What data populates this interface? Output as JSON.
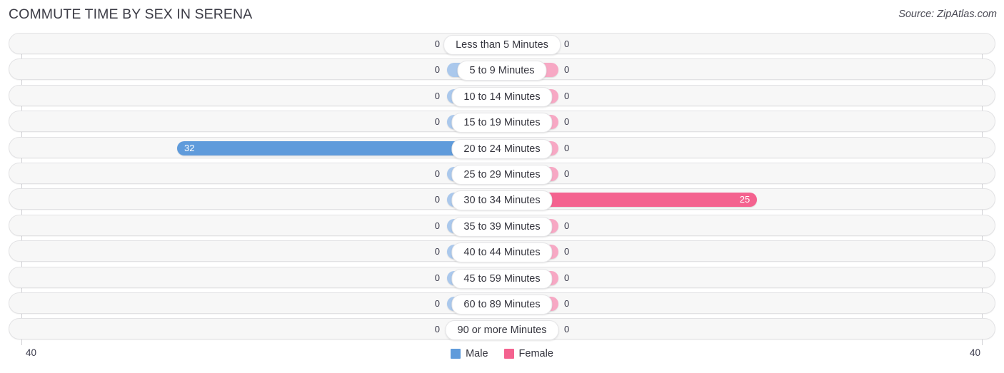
{
  "header": {
    "title": "COMMUTE TIME BY SEX IN SERENA",
    "source": "Source: ZipAtlas.com"
  },
  "axis": {
    "left_tick": "40",
    "right_tick": "40",
    "max": 40
  },
  "legend": {
    "male_label": "Male",
    "female_label": "Female",
    "male_color": "#5f9bdb",
    "female_color": "#f4628f",
    "male_zero_color": "#aac8ec",
    "female_zero_color": "#f7a8c4"
  },
  "chart_data": {
    "type": "bar",
    "title": "COMMUTE TIME BY SEX IN SERENA",
    "subtitle": "",
    "xlabel": "",
    "ylabel": "",
    "orientation": "horizontal-diverging",
    "grid": false,
    "legend_position": "bottom-center",
    "xlim": [
      40,
      40
    ],
    "axis_ticks": [
      "40",
      "40"
    ],
    "categories": [
      "Less than 5 Minutes",
      "5 to 9 Minutes",
      "10 to 14 Minutes",
      "15 to 19 Minutes",
      "20 to 24 Minutes",
      "25 to 29 Minutes",
      "30 to 34 Minutes",
      "35 to 39 Minutes",
      "40 to 44 Minutes",
      "45 to 59 Minutes",
      "60 to 89 Minutes",
      "90 or more Minutes"
    ],
    "series": [
      {
        "name": "Male",
        "color": "#5f9bdb",
        "values": [
          0,
          0,
          0,
          0,
          32,
          0,
          0,
          0,
          0,
          0,
          0,
          0
        ],
        "labels": [
          "0",
          "0",
          "0",
          "0",
          "32",
          "0",
          "0",
          "0",
          "0",
          "0",
          "0",
          "0"
        ]
      },
      {
        "name": "Female",
        "color": "#f4628f",
        "values": [
          0,
          0,
          0,
          0,
          0,
          0,
          25,
          0,
          0,
          0,
          0,
          0
        ],
        "labels": [
          "0",
          "0",
          "0",
          "0",
          "0",
          "0",
          "25",
          "0",
          "0",
          "0",
          "0",
          "0"
        ]
      }
    ]
  }
}
